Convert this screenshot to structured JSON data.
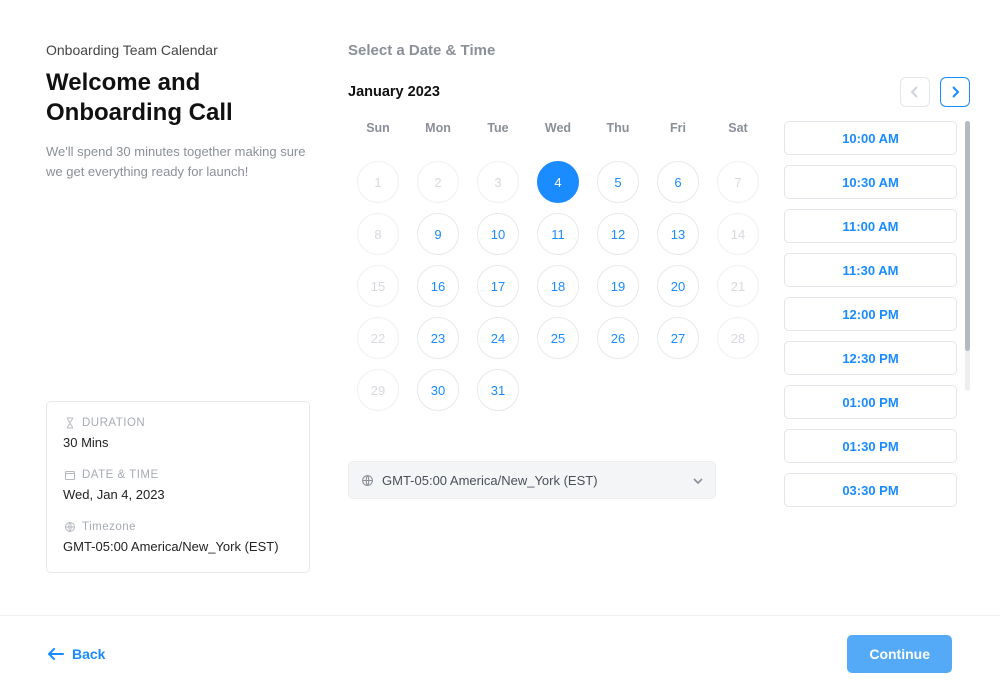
{
  "page": {
    "subtitle": "Onboarding Team Calendar",
    "title": "Welcome and Onboarding Call",
    "description": "We'll spend 30 minutes together making sure we get everything ready for launch!"
  },
  "meta": {
    "duration_label": "DURATION",
    "duration_value": "30 Mins",
    "datetime_label": "DATE & TIME",
    "datetime_value": "Wed, Jan 4, 2023",
    "timezone_label": "Timezone",
    "timezone_value": "GMT-05:00 America/New_York (EST)"
  },
  "picker": {
    "section_title": "Select a Date & Time",
    "month_label": "January 2023",
    "dow": [
      "Sun",
      "Mon",
      "Tue",
      "Wed",
      "Thu",
      "Fri",
      "Sat"
    ],
    "weeks": [
      [
        {
          "n": 1,
          "state": "disabled"
        },
        {
          "n": 2,
          "state": "disabled"
        },
        {
          "n": 3,
          "state": "disabled"
        },
        {
          "n": 4,
          "state": "selected"
        },
        {
          "n": 5,
          "state": "avail"
        },
        {
          "n": 6,
          "state": "avail"
        },
        {
          "n": 7,
          "state": "disabled"
        }
      ],
      [
        {
          "n": 8,
          "state": "disabled"
        },
        {
          "n": 9,
          "state": "avail"
        },
        {
          "n": 10,
          "state": "avail"
        },
        {
          "n": 11,
          "state": "avail"
        },
        {
          "n": 12,
          "state": "avail"
        },
        {
          "n": 13,
          "state": "avail"
        },
        {
          "n": 14,
          "state": "disabled"
        }
      ],
      [
        {
          "n": 15,
          "state": "disabled"
        },
        {
          "n": 16,
          "state": "avail"
        },
        {
          "n": 17,
          "state": "avail"
        },
        {
          "n": 18,
          "state": "avail"
        },
        {
          "n": 19,
          "state": "avail"
        },
        {
          "n": 20,
          "state": "avail"
        },
        {
          "n": 21,
          "state": "disabled"
        }
      ],
      [
        {
          "n": 22,
          "state": "disabled"
        },
        {
          "n": 23,
          "state": "avail"
        },
        {
          "n": 24,
          "state": "avail"
        },
        {
          "n": 25,
          "state": "avail"
        },
        {
          "n": 26,
          "state": "avail"
        },
        {
          "n": 27,
          "state": "avail"
        },
        {
          "n": 28,
          "state": "disabled"
        }
      ],
      [
        {
          "n": 29,
          "state": "disabled"
        },
        {
          "n": 30,
          "state": "avail"
        },
        {
          "n": 31,
          "state": "avail"
        },
        {
          "n": null,
          "state": "empty"
        },
        {
          "n": null,
          "state": "empty"
        },
        {
          "n": null,
          "state": "empty"
        },
        {
          "n": null,
          "state": "empty"
        }
      ]
    ],
    "timezone_selected": "GMT-05:00 America/New_York (EST)",
    "times": [
      "10:00 AM",
      "10:30 AM",
      "11:00 AM",
      "11:30 AM",
      "12:00 PM",
      "12:30 PM",
      "01:00 PM",
      "01:30 PM",
      "03:30 PM"
    ]
  },
  "footer": {
    "back_label": "Back",
    "continue_label": "Continue"
  }
}
